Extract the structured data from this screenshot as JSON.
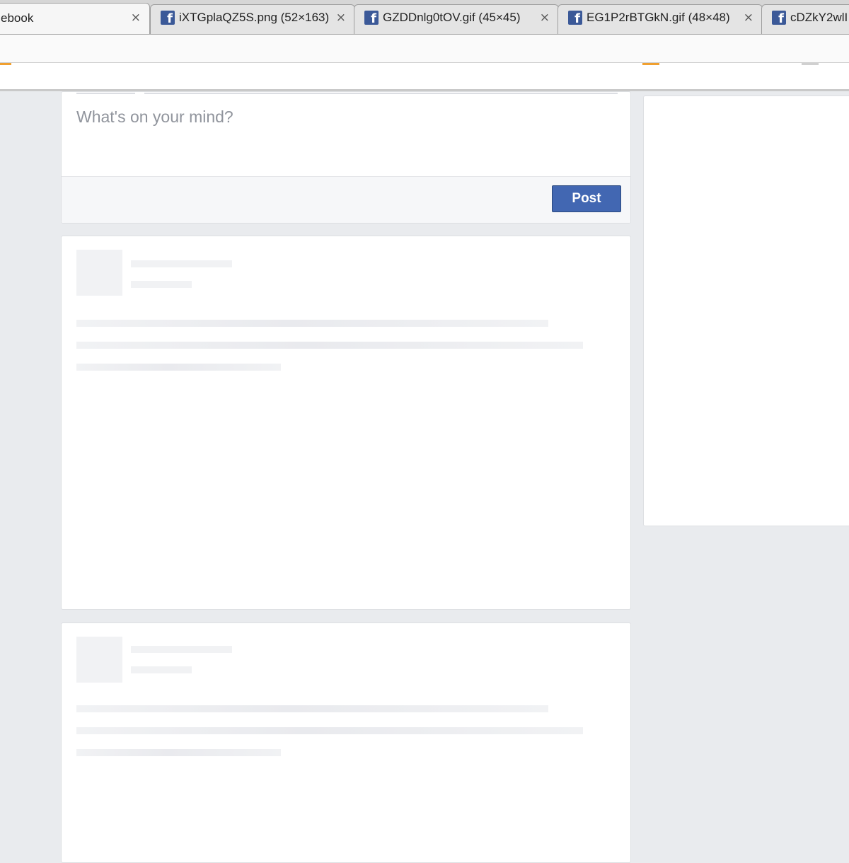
{
  "browser": {
    "tabs": [
      {
        "title": "ebook",
        "active": true
      },
      {
        "title": "iXTGplaQZ5S.png (52×163)",
        "active": false
      },
      {
        "title": "GZDDnlg0tOV.gif (45×45)",
        "active": false
      },
      {
        "title": "EG1P2rBTGkN.gif (48×48)",
        "active": false
      },
      {
        "title": "cDZkY2wlI",
        "active": false
      }
    ],
    "close_glyph": "×",
    "favicon_glyph": "f"
  },
  "composer": {
    "placeholder": "What's on your mind?",
    "post_label": "Post"
  },
  "colors": {
    "page_bg": "#e9ebee",
    "accent": "#4267b2",
    "placeholder_text": "#90949c",
    "skeleton": "#f1f2f4"
  },
  "feed": {
    "loading_cards": 2
  }
}
